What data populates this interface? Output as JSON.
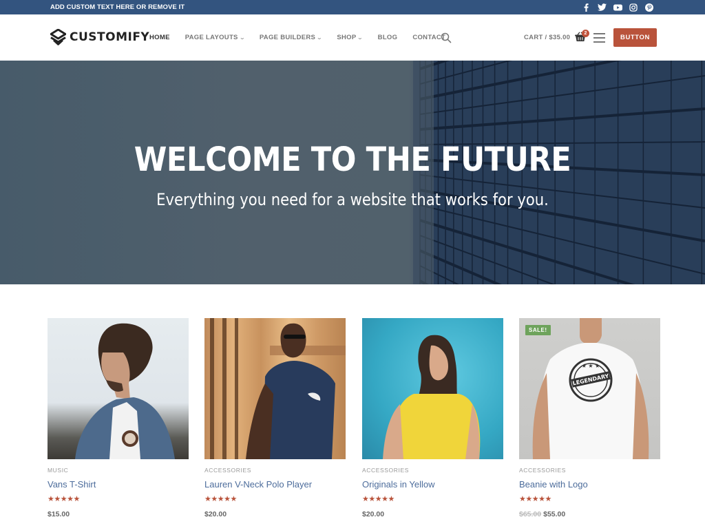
{
  "topbar": {
    "text": "ADD CUSTOM TEXT HERE OR REMOVE IT",
    "social_icons": [
      "facebook-icon",
      "twitter-icon",
      "youtube-icon",
      "instagram-icon",
      "pinterest-icon"
    ]
  },
  "header": {
    "logo_text": "CUSTOMIFY",
    "nav": [
      {
        "label": "HOME",
        "active": true,
        "dropdown": false
      },
      {
        "label": "PAGE LAYOUTS",
        "active": false,
        "dropdown": true
      },
      {
        "label": "PAGE BUILDERS",
        "active": false,
        "dropdown": true
      },
      {
        "label": "SHOP",
        "active": false,
        "dropdown": true
      },
      {
        "label": "BLOG",
        "active": false,
        "dropdown": false
      },
      {
        "label": "CONTACT",
        "active": false,
        "dropdown": false
      }
    ],
    "dropdown_glyph": "⌄",
    "cart_label": "CART / $35.00",
    "cart_count": "2",
    "button_label": "BUTTON"
  },
  "hero": {
    "title": "WELCOME TO THE FUTURE",
    "subtitle": "Everything you need for a website that works for you."
  },
  "products": [
    {
      "category": "MUSIC",
      "name": "Vans T-Shirt",
      "rating": 5,
      "stars": "★★★★★",
      "old_price": "",
      "price": "$15.00",
      "sale": false
    },
    {
      "category": "ACCESSORIES",
      "name": "Lauren V-Neck Polo Player",
      "rating": 5,
      "stars": "★★★★★",
      "old_price": "",
      "price": "$20.00",
      "sale": false
    },
    {
      "category": "ACCESSORIES",
      "name": "Originals in Yellow",
      "rating": 5,
      "stars": "★★★★★",
      "old_price": "",
      "price": "$20.00",
      "sale": false
    },
    {
      "category": "ACCESSORIES",
      "name": "Beanie with Logo",
      "rating": 5,
      "stars": "★★★★★",
      "old_price": "$65.00",
      "price": "$55.00",
      "sale": true,
      "sale_label": "SALE!"
    }
  ],
  "colors": {
    "topbar": "#33547f",
    "accent": "#b9533b",
    "link": "#4c6c9b",
    "sale_badge": "#6ea35c"
  }
}
